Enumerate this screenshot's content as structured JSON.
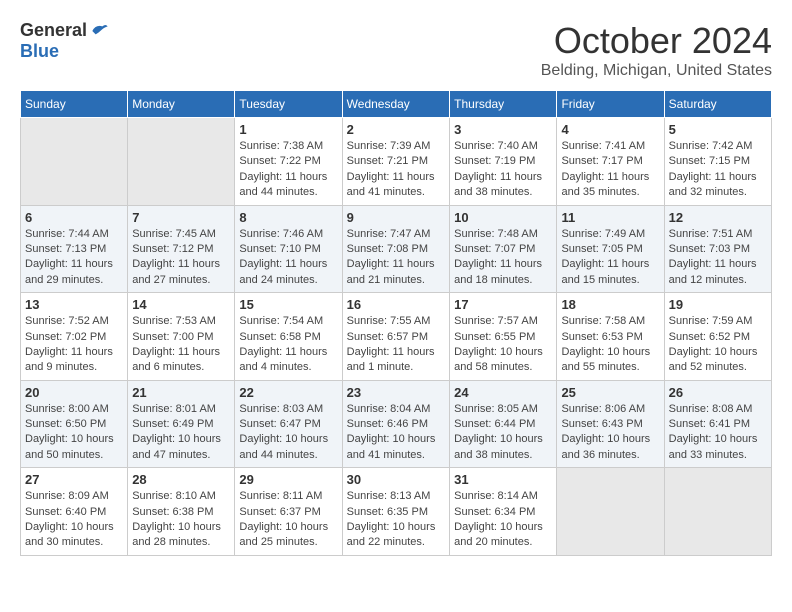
{
  "header": {
    "logo_general": "General",
    "logo_blue": "Blue",
    "month_title": "October 2024",
    "location": "Belding, Michigan, United States"
  },
  "days_of_week": [
    "Sunday",
    "Monday",
    "Tuesday",
    "Wednesday",
    "Thursday",
    "Friday",
    "Saturday"
  ],
  "weeks": [
    {
      "days": [
        {
          "number": "",
          "empty": true
        },
        {
          "number": "",
          "empty": true
        },
        {
          "number": "1",
          "sunrise": "Sunrise: 7:38 AM",
          "sunset": "Sunset: 7:22 PM",
          "daylight": "Daylight: 11 hours and 44 minutes."
        },
        {
          "number": "2",
          "sunrise": "Sunrise: 7:39 AM",
          "sunset": "Sunset: 7:21 PM",
          "daylight": "Daylight: 11 hours and 41 minutes."
        },
        {
          "number": "3",
          "sunrise": "Sunrise: 7:40 AM",
          "sunset": "Sunset: 7:19 PM",
          "daylight": "Daylight: 11 hours and 38 minutes."
        },
        {
          "number": "4",
          "sunrise": "Sunrise: 7:41 AM",
          "sunset": "Sunset: 7:17 PM",
          "daylight": "Daylight: 11 hours and 35 minutes."
        },
        {
          "number": "5",
          "sunrise": "Sunrise: 7:42 AM",
          "sunset": "Sunset: 7:15 PM",
          "daylight": "Daylight: 11 hours and 32 minutes."
        }
      ]
    },
    {
      "days": [
        {
          "number": "6",
          "sunrise": "Sunrise: 7:44 AM",
          "sunset": "Sunset: 7:13 PM",
          "daylight": "Daylight: 11 hours and 29 minutes."
        },
        {
          "number": "7",
          "sunrise": "Sunrise: 7:45 AM",
          "sunset": "Sunset: 7:12 PM",
          "daylight": "Daylight: 11 hours and 27 minutes."
        },
        {
          "number": "8",
          "sunrise": "Sunrise: 7:46 AM",
          "sunset": "Sunset: 7:10 PM",
          "daylight": "Daylight: 11 hours and 24 minutes."
        },
        {
          "number": "9",
          "sunrise": "Sunrise: 7:47 AM",
          "sunset": "Sunset: 7:08 PM",
          "daylight": "Daylight: 11 hours and 21 minutes."
        },
        {
          "number": "10",
          "sunrise": "Sunrise: 7:48 AM",
          "sunset": "Sunset: 7:07 PM",
          "daylight": "Daylight: 11 hours and 18 minutes."
        },
        {
          "number": "11",
          "sunrise": "Sunrise: 7:49 AM",
          "sunset": "Sunset: 7:05 PM",
          "daylight": "Daylight: 11 hours and 15 minutes."
        },
        {
          "number": "12",
          "sunrise": "Sunrise: 7:51 AM",
          "sunset": "Sunset: 7:03 PM",
          "daylight": "Daylight: 11 hours and 12 minutes."
        }
      ]
    },
    {
      "days": [
        {
          "number": "13",
          "sunrise": "Sunrise: 7:52 AM",
          "sunset": "Sunset: 7:02 PM",
          "daylight": "Daylight: 11 hours and 9 minutes."
        },
        {
          "number": "14",
          "sunrise": "Sunrise: 7:53 AM",
          "sunset": "Sunset: 7:00 PM",
          "daylight": "Daylight: 11 hours and 6 minutes."
        },
        {
          "number": "15",
          "sunrise": "Sunrise: 7:54 AM",
          "sunset": "Sunset: 6:58 PM",
          "daylight": "Daylight: 11 hours and 4 minutes."
        },
        {
          "number": "16",
          "sunrise": "Sunrise: 7:55 AM",
          "sunset": "Sunset: 6:57 PM",
          "daylight": "Daylight: 11 hours and 1 minute."
        },
        {
          "number": "17",
          "sunrise": "Sunrise: 7:57 AM",
          "sunset": "Sunset: 6:55 PM",
          "daylight": "Daylight: 10 hours and 58 minutes."
        },
        {
          "number": "18",
          "sunrise": "Sunrise: 7:58 AM",
          "sunset": "Sunset: 6:53 PM",
          "daylight": "Daylight: 10 hours and 55 minutes."
        },
        {
          "number": "19",
          "sunrise": "Sunrise: 7:59 AM",
          "sunset": "Sunset: 6:52 PM",
          "daylight": "Daylight: 10 hours and 52 minutes."
        }
      ]
    },
    {
      "days": [
        {
          "number": "20",
          "sunrise": "Sunrise: 8:00 AM",
          "sunset": "Sunset: 6:50 PM",
          "daylight": "Daylight: 10 hours and 50 minutes."
        },
        {
          "number": "21",
          "sunrise": "Sunrise: 8:01 AM",
          "sunset": "Sunset: 6:49 PM",
          "daylight": "Daylight: 10 hours and 47 minutes."
        },
        {
          "number": "22",
          "sunrise": "Sunrise: 8:03 AM",
          "sunset": "Sunset: 6:47 PM",
          "daylight": "Daylight: 10 hours and 44 minutes."
        },
        {
          "number": "23",
          "sunrise": "Sunrise: 8:04 AM",
          "sunset": "Sunset: 6:46 PM",
          "daylight": "Daylight: 10 hours and 41 minutes."
        },
        {
          "number": "24",
          "sunrise": "Sunrise: 8:05 AM",
          "sunset": "Sunset: 6:44 PM",
          "daylight": "Daylight: 10 hours and 38 minutes."
        },
        {
          "number": "25",
          "sunrise": "Sunrise: 8:06 AM",
          "sunset": "Sunset: 6:43 PM",
          "daylight": "Daylight: 10 hours and 36 minutes."
        },
        {
          "number": "26",
          "sunrise": "Sunrise: 8:08 AM",
          "sunset": "Sunset: 6:41 PM",
          "daylight": "Daylight: 10 hours and 33 minutes."
        }
      ]
    },
    {
      "days": [
        {
          "number": "27",
          "sunrise": "Sunrise: 8:09 AM",
          "sunset": "Sunset: 6:40 PM",
          "daylight": "Daylight: 10 hours and 30 minutes."
        },
        {
          "number": "28",
          "sunrise": "Sunrise: 8:10 AM",
          "sunset": "Sunset: 6:38 PM",
          "daylight": "Daylight: 10 hours and 28 minutes."
        },
        {
          "number": "29",
          "sunrise": "Sunrise: 8:11 AM",
          "sunset": "Sunset: 6:37 PM",
          "daylight": "Daylight: 10 hours and 25 minutes."
        },
        {
          "number": "30",
          "sunrise": "Sunrise: 8:13 AM",
          "sunset": "Sunset: 6:35 PM",
          "daylight": "Daylight: 10 hours and 22 minutes."
        },
        {
          "number": "31",
          "sunrise": "Sunrise: 8:14 AM",
          "sunset": "Sunset: 6:34 PM",
          "daylight": "Daylight: 10 hours and 20 minutes."
        },
        {
          "number": "",
          "empty": true
        },
        {
          "number": "",
          "empty": true
        }
      ]
    }
  ]
}
